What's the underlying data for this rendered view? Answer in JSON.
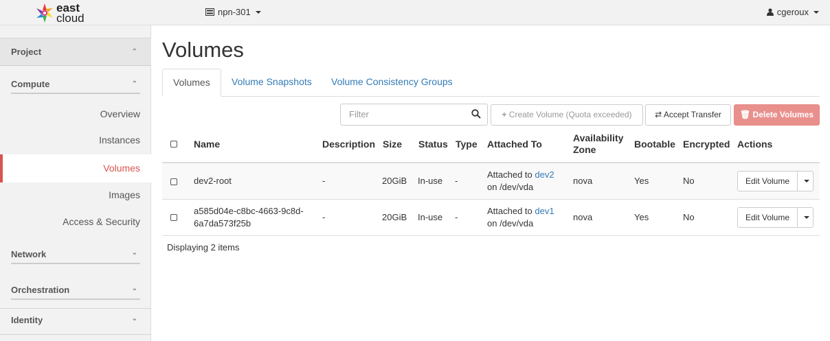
{
  "header": {
    "logo_line1": "east",
    "logo_line2": "cloud",
    "project": "npn-301",
    "user": "cgeroux"
  },
  "sidebar": {
    "project": "Project",
    "compute": "Compute",
    "items": [
      "Overview",
      "Instances",
      "Volumes",
      "Images",
      "Access & Security"
    ],
    "network": "Network",
    "orchestration": "Orchestration",
    "identity": "Identity"
  },
  "main": {
    "title": "Volumes",
    "tabs": [
      "Volumes",
      "Volume Snapshots",
      "Volume Consistency Groups"
    ],
    "filter_placeholder": "Filter",
    "create_button": "Create Volume (Quota exceeded)",
    "accept_transfer": "Accept Transfer",
    "delete_button": "Delete Volumes",
    "columns": {
      "name": "Name",
      "description": "Description",
      "size": "Size",
      "status": "Status",
      "type": "Type",
      "attached_to": "Attached To",
      "availability_zone": "Availability Zone",
      "bootable": "Bootable",
      "encrypted": "Encrypted",
      "actions": "Actions"
    },
    "rows": [
      {
        "name": "dev2-root",
        "name_line2": "",
        "description": "-",
        "size": "20GiB",
        "status": "In-use",
        "type": "-",
        "attached_prefix": "Attached to ",
        "attached_link": "dev2",
        "attached_suffix": "on /dev/vda",
        "zone": "nova",
        "bootable": "Yes",
        "encrypted": "No",
        "action": "Edit Volume"
      },
      {
        "name": "a585d04e-c8bc-4663-9c8d-",
        "name_line2": "6a7da573f25b",
        "description": "-",
        "size": "20GiB",
        "status": "In-use",
        "type": "-",
        "attached_prefix": "Attached to ",
        "attached_link": "dev1",
        "attached_suffix": "on /dev/vda",
        "zone": "nova",
        "bootable": "Yes",
        "encrypted": "No",
        "action": "Edit Volume"
      }
    ],
    "footer": "Displaying 2 items"
  },
  "colors": {
    "accent": "#d9534f",
    "link": "#337ab7",
    "sidebar_bg": "#f2f2f2",
    "danger_button": "#e9908d"
  }
}
